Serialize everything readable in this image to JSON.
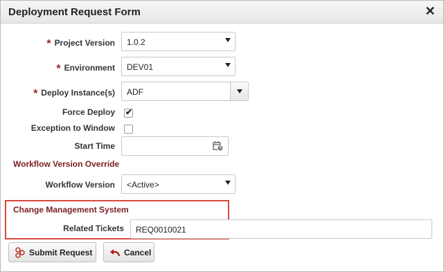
{
  "dialog": {
    "title": "Deployment Request Form",
    "close_icon": "close-icon"
  },
  "form": {
    "required_marker": "*",
    "project_version": {
      "label": "Project Version",
      "value": "1.0.2"
    },
    "environment": {
      "label": "Environment",
      "value": "DEV01"
    },
    "deploy_instance": {
      "label": "Deploy Instance(s)",
      "value": "ADF"
    },
    "force_deploy": {
      "label": "Force Deploy",
      "checked": true,
      "check_glyph": "✔"
    },
    "exception_to_window": {
      "label": "Exception to Window",
      "checked": false
    },
    "start_time": {
      "label": "Start Time",
      "value": "",
      "icon": "calendar-clock-icon"
    },
    "workflow_override_heading": "Workflow Version Override",
    "workflow_version": {
      "label": "Workflow Version",
      "value": "<Active>"
    },
    "cms_heading": "Change Management System",
    "related_tickets": {
      "label": "Related Tickets",
      "value": "REQ0010021"
    }
  },
  "buttons": {
    "submit": {
      "label": "Submit Request",
      "icon": "submit-icon"
    },
    "cancel": {
      "label": "Cancel",
      "icon": "undo-arrow-icon"
    }
  },
  "colors": {
    "section_heading": "#7b1f22",
    "required_marker": "#a02020",
    "highlight_border": "#d9473f",
    "cancel_icon": "#b01a1a",
    "submit_icon": "#c0392b"
  }
}
